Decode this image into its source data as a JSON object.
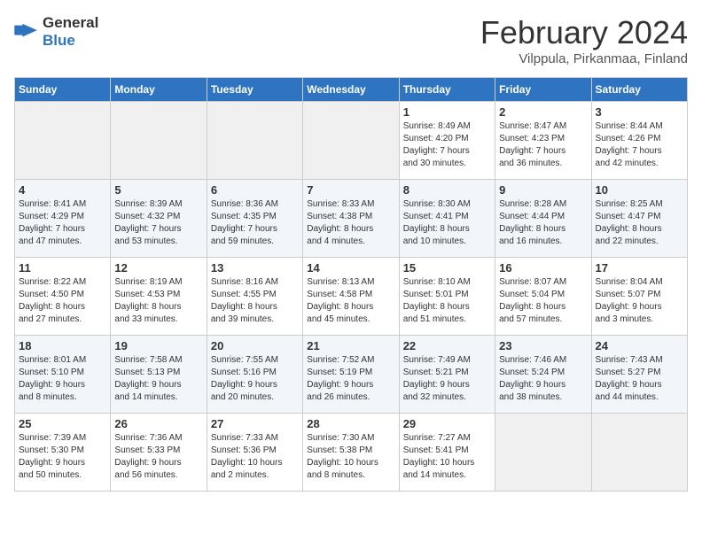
{
  "logo": {
    "general": "General",
    "blue": "Blue"
  },
  "header": {
    "month": "February 2024",
    "location": "Vilppula, Pirkanmaa, Finland"
  },
  "days_of_week": [
    "Sunday",
    "Monday",
    "Tuesday",
    "Wednesday",
    "Thursday",
    "Friday",
    "Saturday"
  ],
  "weeks": [
    [
      {
        "day": "",
        "info": "",
        "empty": true
      },
      {
        "day": "",
        "info": "",
        "empty": true
      },
      {
        "day": "",
        "info": "",
        "empty": true
      },
      {
        "day": "",
        "info": "",
        "empty": true
      },
      {
        "day": "1",
        "info": "Sunrise: 8:49 AM\nSunset: 4:20 PM\nDaylight: 7 hours\nand 30 minutes.",
        "empty": false
      },
      {
        "day": "2",
        "info": "Sunrise: 8:47 AM\nSunset: 4:23 PM\nDaylight: 7 hours\nand 36 minutes.",
        "empty": false
      },
      {
        "day": "3",
        "info": "Sunrise: 8:44 AM\nSunset: 4:26 PM\nDaylight: 7 hours\nand 42 minutes.",
        "empty": false
      }
    ],
    [
      {
        "day": "4",
        "info": "Sunrise: 8:41 AM\nSunset: 4:29 PM\nDaylight: 7 hours\nand 47 minutes.",
        "empty": false
      },
      {
        "day": "5",
        "info": "Sunrise: 8:39 AM\nSunset: 4:32 PM\nDaylight: 7 hours\nand 53 minutes.",
        "empty": false
      },
      {
        "day": "6",
        "info": "Sunrise: 8:36 AM\nSunset: 4:35 PM\nDaylight: 7 hours\nand 59 minutes.",
        "empty": false
      },
      {
        "day": "7",
        "info": "Sunrise: 8:33 AM\nSunset: 4:38 PM\nDaylight: 8 hours\nand 4 minutes.",
        "empty": false
      },
      {
        "day": "8",
        "info": "Sunrise: 8:30 AM\nSunset: 4:41 PM\nDaylight: 8 hours\nand 10 minutes.",
        "empty": false
      },
      {
        "day": "9",
        "info": "Sunrise: 8:28 AM\nSunset: 4:44 PM\nDaylight: 8 hours\nand 16 minutes.",
        "empty": false
      },
      {
        "day": "10",
        "info": "Sunrise: 8:25 AM\nSunset: 4:47 PM\nDaylight: 8 hours\nand 22 minutes.",
        "empty": false
      }
    ],
    [
      {
        "day": "11",
        "info": "Sunrise: 8:22 AM\nSunset: 4:50 PM\nDaylight: 8 hours\nand 27 minutes.",
        "empty": false
      },
      {
        "day": "12",
        "info": "Sunrise: 8:19 AM\nSunset: 4:53 PM\nDaylight: 8 hours\nand 33 minutes.",
        "empty": false
      },
      {
        "day": "13",
        "info": "Sunrise: 8:16 AM\nSunset: 4:55 PM\nDaylight: 8 hours\nand 39 minutes.",
        "empty": false
      },
      {
        "day": "14",
        "info": "Sunrise: 8:13 AM\nSunset: 4:58 PM\nDaylight: 8 hours\nand 45 minutes.",
        "empty": false
      },
      {
        "day": "15",
        "info": "Sunrise: 8:10 AM\nSunset: 5:01 PM\nDaylight: 8 hours\nand 51 minutes.",
        "empty": false
      },
      {
        "day": "16",
        "info": "Sunrise: 8:07 AM\nSunset: 5:04 PM\nDaylight: 8 hours\nand 57 minutes.",
        "empty": false
      },
      {
        "day": "17",
        "info": "Sunrise: 8:04 AM\nSunset: 5:07 PM\nDaylight: 9 hours\nand 3 minutes.",
        "empty": false
      }
    ],
    [
      {
        "day": "18",
        "info": "Sunrise: 8:01 AM\nSunset: 5:10 PM\nDaylight: 9 hours\nand 8 minutes.",
        "empty": false
      },
      {
        "day": "19",
        "info": "Sunrise: 7:58 AM\nSunset: 5:13 PM\nDaylight: 9 hours\nand 14 minutes.",
        "empty": false
      },
      {
        "day": "20",
        "info": "Sunrise: 7:55 AM\nSunset: 5:16 PM\nDaylight: 9 hours\nand 20 minutes.",
        "empty": false
      },
      {
        "day": "21",
        "info": "Sunrise: 7:52 AM\nSunset: 5:19 PM\nDaylight: 9 hours\nand 26 minutes.",
        "empty": false
      },
      {
        "day": "22",
        "info": "Sunrise: 7:49 AM\nSunset: 5:21 PM\nDaylight: 9 hours\nand 32 minutes.",
        "empty": false
      },
      {
        "day": "23",
        "info": "Sunrise: 7:46 AM\nSunset: 5:24 PM\nDaylight: 9 hours\nand 38 minutes.",
        "empty": false
      },
      {
        "day": "24",
        "info": "Sunrise: 7:43 AM\nSunset: 5:27 PM\nDaylight: 9 hours\nand 44 minutes.",
        "empty": false
      }
    ],
    [
      {
        "day": "25",
        "info": "Sunrise: 7:39 AM\nSunset: 5:30 PM\nDaylight: 9 hours\nand 50 minutes.",
        "empty": false
      },
      {
        "day": "26",
        "info": "Sunrise: 7:36 AM\nSunset: 5:33 PM\nDaylight: 9 hours\nand 56 minutes.",
        "empty": false
      },
      {
        "day": "27",
        "info": "Sunrise: 7:33 AM\nSunset: 5:36 PM\nDaylight: 10 hours\nand 2 minutes.",
        "empty": false
      },
      {
        "day": "28",
        "info": "Sunrise: 7:30 AM\nSunset: 5:38 PM\nDaylight: 10 hours\nand 8 minutes.",
        "empty": false
      },
      {
        "day": "29",
        "info": "Sunrise: 7:27 AM\nSunset: 5:41 PM\nDaylight: 10 hours\nand 14 minutes.",
        "empty": false
      },
      {
        "day": "",
        "info": "",
        "empty": true
      },
      {
        "day": "",
        "info": "",
        "empty": true
      }
    ]
  ]
}
